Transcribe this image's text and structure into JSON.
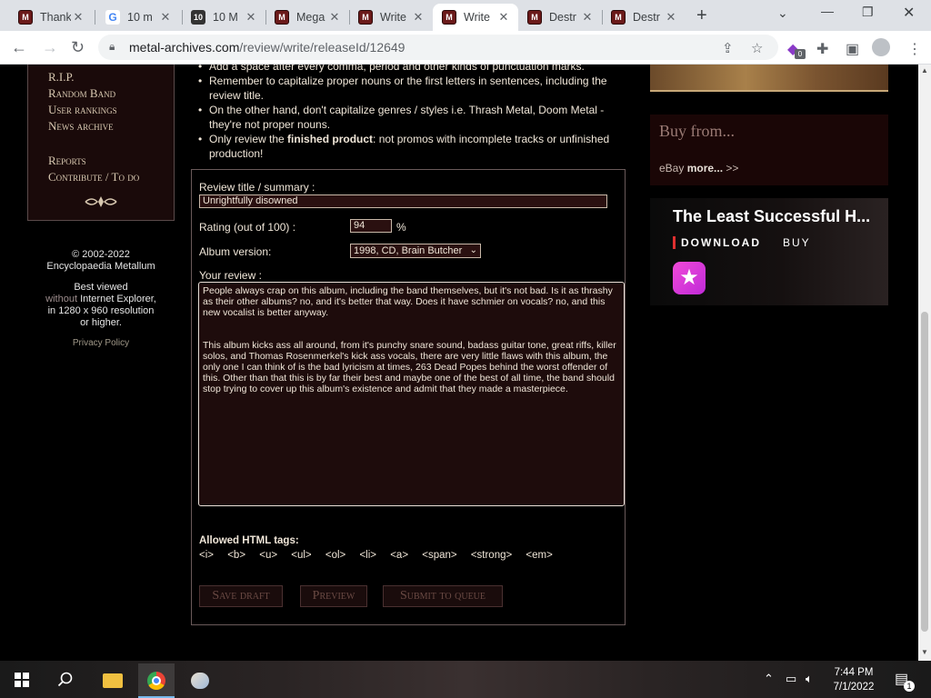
{
  "browser": {
    "tabs": [
      {
        "title": "Thank",
        "icon": "metal-archives-icon"
      },
      {
        "title": "10 m",
        "icon": "google-icon"
      },
      {
        "title": "10 M",
        "icon": "ten-icon"
      },
      {
        "title": "Mega",
        "icon": "metal-archives-icon"
      },
      {
        "title": "Write",
        "icon": "metal-archives-icon"
      },
      {
        "title": "Write",
        "icon": "metal-archives-icon",
        "active": true
      },
      {
        "title": "Destr",
        "icon": "metal-archives-icon"
      },
      {
        "title": "Destr",
        "icon": "metal-archives-icon"
      }
    ],
    "url_host": "metal-archives.com",
    "url_path": "/review/write/releaseId/12649",
    "extension_badge": "0"
  },
  "leftmenu": {
    "items": [
      "R.I.P.",
      "Random Band",
      "User rankings",
      "News archive",
      "Reports",
      "Contribute / To do"
    ],
    "copyright_line1": "© 2002-2022",
    "copyright_line2": "Encyclopaedia Metallum",
    "best_viewed_1": "Best viewed",
    "best_viewed_without": "without",
    "best_viewed_2": " Internet Explorer,",
    "best_viewed_3": "in 1280 x 960 resolution",
    "best_viewed_4": "or higher.",
    "privacy": "Privacy Policy"
  },
  "rules": [
    {
      "text": "Add a space after every comma, period and other kinds of punctuation marks."
    },
    {
      "text": "Remember to capitalize proper nouns or the first letters in sentences, including the review title."
    },
    {
      "text": "On the other hand, don't capitalize genres / styles i.e. Thrash Metal, Doom Metal - they're not proper nouns."
    },
    {
      "pre": "Only review the ",
      "bold": "finished product",
      "post": ": not promos with incomplete tracks or unfinished production!"
    }
  ],
  "form": {
    "title_label": "Review title / summary :",
    "title_value": "Unrightfully disowned",
    "rating_label": "Rating (out of 100) :",
    "rating_value": "94",
    "rating_unit": "%",
    "album_label": "Album version:",
    "album_value": "1998, CD, Brain Butcher",
    "review_label": "Your review :",
    "review_p1": "People always crap on this album, including the band themselves, but it's not bad. Is it as thrashy as their other albums? no, and it's better that way. Does it have schmier on vocals? no, and this new vocalist is better anyway.",
    "review_p2": "This album kicks ass all around, from it's punchy snare sound, badass guitar tone, great riffs, killer solos, and Thomas Rosenmerkel's kick ass vocals, there are very little flaws with this album, the only one I can think of is the bad lyricism at times, 263 Dead Popes behind the worst offender of this. Other than that this is by far their best and maybe one of the best of all time, the band should stop trying to cover up this album's existence and admit that they made a masterpiece.",
    "allowed_label": "Allowed HTML tags:",
    "tags": [
      "<i>",
      "<b>",
      "<u>",
      "<ul>",
      "<ol>",
      "<li>",
      "<a>",
      "<span>",
      "<strong>",
      "<em>"
    ],
    "btn_save": "Save draft",
    "btn_preview": "Preview",
    "btn_submit": "Submit to queue"
  },
  "sidebar": {
    "buy_heading": "Buy from...",
    "ebay_prefix": "eBay ",
    "ebay_more": "more...",
    "ebay_suffix": " >>",
    "ad_title": "The Least Successful H...",
    "ad_download": "DOWNLOAD",
    "ad_buy": "BUY"
  },
  "taskbar": {
    "time": "7:44 PM",
    "date": "7/1/2022",
    "notification_count": "1"
  }
}
